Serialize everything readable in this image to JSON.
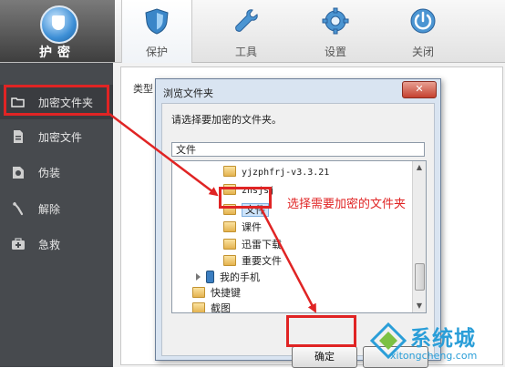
{
  "app": {
    "logo_text": "护密"
  },
  "tabs": [
    {
      "label": "保护",
      "icon": "shield-icon",
      "active": true
    },
    {
      "label": "工具",
      "icon": "wrench-icon",
      "active": false
    },
    {
      "label": "设置",
      "icon": "gear-icon",
      "active": false
    },
    {
      "label": "关闭",
      "icon": "power-icon",
      "active": false
    }
  ],
  "sidebar": {
    "items": [
      {
        "label": "加密文件夹",
        "icon": "folder-open-icon",
        "selected": true
      },
      {
        "label": "加密文件",
        "icon": "file-icon",
        "selected": false
      },
      {
        "label": "伪装",
        "icon": "disguise-icon",
        "selected": false
      },
      {
        "label": "解除",
        "icon": "unlock-icon",
        "selected": false
      },
      {
        "label": "急救",
        "icon": "first-aid-icon",
        "selected": false
      }
    ]
  },
  "main": {
    "column_header": "类型"
  },
  "dialog": {
    "title": "浏览文件夹",
    "close_label": "✕",
    "prompt": "请选择要加密的文件夹。",
    "folder_value": "文件",
    "tree": [
      {
        "label": "yjzphfrj-v3.3.21",
        "type": "folder"
      },
      {
        "label": "znsjsj",
        "type": "folder"
      },
      {
        "label": "文件",
        "type": "folder",
        "selected": true
      },
      {
        "label": "课件",
        "type": "folder"
      },
      {
        "label": "迅雷下载",
        "type": "folder"
      },
      {
        "label": "重要文件",
        "type": "folder"
      },
      {
        "label": "我的手机",
        "type": "phone"
      },
      {
        "label": "快捷键",
        "type": "folder"
      },
      {
        "label": "截图",
        "type": "folder"
      }
    ],
    "ok_label": "确定",
    "cancel_label": ""
  },
  "annotation": {
    "text": "选择需要加密的文件夹",
    "color": "#e02424"
  },
  "watermark": {
    "brand": "系统城",
    "url": "xitongcheng.com"
  },
  "colors": {
    "accent_red": "#e02424",
    "sidebar_bg": "#474a4e",
    "watermark_blue": "#2a9ed8"
  }
}
